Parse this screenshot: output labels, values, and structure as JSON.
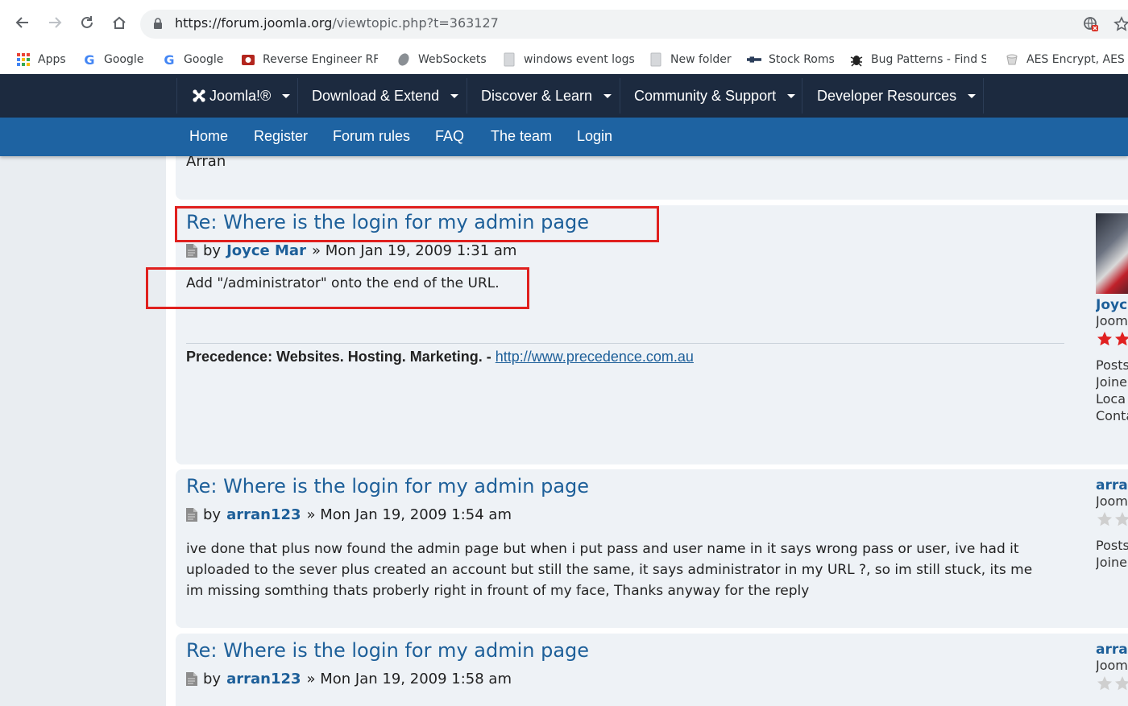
{
  "browser": {
    "url_host": "https://forum.joomla.org",
    "url_path": "/viewtopic.php?t=363127",
    "bookmarks": [
      {
        "label": "Apps",
        "icon": "apps-grid-icon"
      },
      {
        "label": "Google",
        "icon": "google-icon"
      },
      {
        "label": "Google",
        "icon": "google-icon"
      },
      {
        "label": "Reverse Engineer RF",
        "icon": "reverse-engineer-icon"
      },
      {
        "label": "WebSockets",
        "icon": "websockets-icon"
      },
      {
        "label": "windows event logs",
        "icon": "page-icon"
      },
      {
        "label": "New folder",
        "icon": "page-icon"
      },
      {
        "label": "Stock Roms",
        "icon": "stock-roms-icon"
      },
      {
        "label": "Bug Patterns - Find S",
        "icon": "bug-icon"
      },
      {
        "label": "AES Encrypt, AES D",
        "icon": "aes-icon"
      }
    ]
  },
  "topnav": {
    "brand": "Joomla!®",
    "items": [
      "Download & Extend",
      "Discover & Learn",
      "Community & Support",
      "Developer Resources"
    ]
  },
  "subnav": {
    "items": [
      "Home",
      "Register",
      "Forum rules",
      "FAQ",
      "The team",
      "Login"
    ]
  },
  "prev_post": {
    "signoff": "Arran"
  },
  "posts": [
    {
      "title": "Re: Where is the login for my admin page",
      "by": "by",
      "author": "Joyce Mar",
      "date": "» Mon Jan 19, 2009 1:31 am",
      "body": [
        "Add \"/administrator\" onto the end of the URL."
      ],
      "signature_bold": "Precedence: Websites. Hosting. Marketing. -",
      "signature_link": "http://www.precedence.com.au",
      "profile": [
        "Joyc",
        "Joom",
        "Posts",
        "Joine",
        "Loca",
        "Conta"
      ]
    },
    {
      "title": "Re: Where is the login for my admin page",
      "by": "by",
      "author": "arran123",
      "date": "» Mon Jan 19, 2009 1:54 am",
      "body": [
        "ive done that plus now found the admin page but when i put pass and user name in it says wrong pass or user, ive had it",
        "uploaded to the sever plus created an account but still the same, it says administrator in my URL ?, so im still stuck, its me",
        "im missing somthing thats proberly right in frount of my face, Thanks anyway for the reply"
      ],
      "profile": [
        "arran",
        "Joom",
        "Posts",
        "Joine"
      ]
    },
    {
      "title": "Re: Where is the login for my admin page",
      "by": "by",
      "author": "arran123",
      "date": "» Mon Jan 19, 2009 1:58 am",
      "profile": [
        "arran",
        "Joom"
      ]
    }
  ],
  "colors": {
    "topnav_bg": "#1c2a3f",
    "subnav_bg": "#1e63a2",
    "link": "#1d5f99",
    "highlight": "#e0201e",
    "star_filled": "#e02020",
    "star_empty": "#cfcfcf"
  }
}
